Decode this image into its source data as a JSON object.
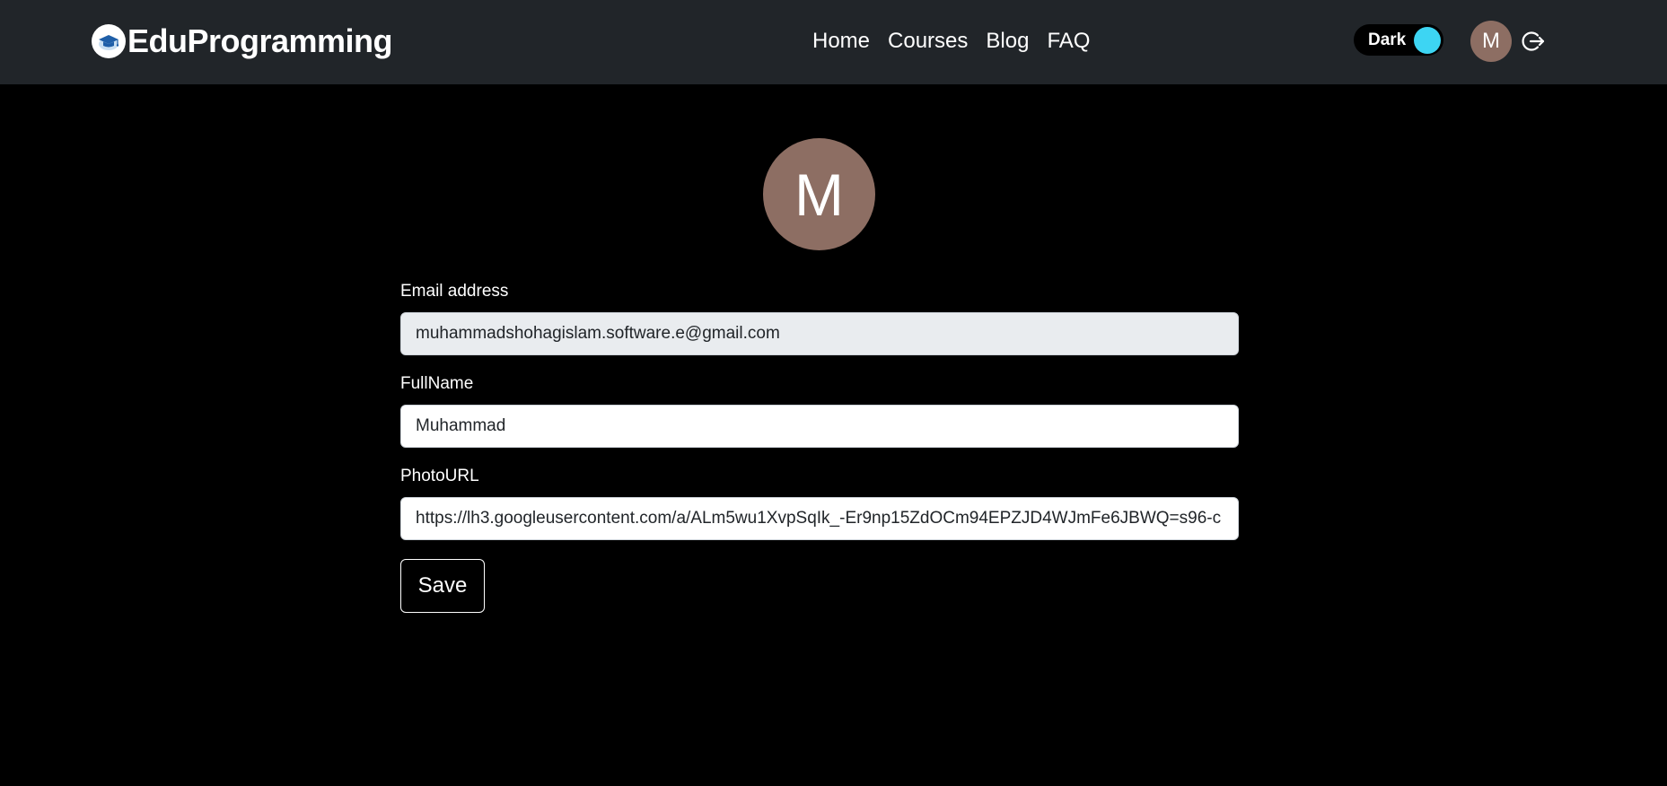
{
  "navbar": {
    "brand_name": "EduProgramming",
    "links": [
      {
        "label": "Home"
      },
      {
        "label": "Courses"
      },
      {
        "label": "Blog"
      },
      {
        "label": "FAQ"
      }
    ],
    "theme_toggle_label": "Dark",
    "avatar_initial": "M",
    "logout_icon": "logout-icon"
  },
  "profile": {
    "avatar_initial": "M",
    "email_label": "Email address",
    "email_value": "muhammadshohagislam.software.e@gmail.com",
    "fullname_label": "FullName",
    "fullname_value": "Muhammad",
    "photourl_label": "PhotoURL",
    "photourl_value": "https://lh3.googleusercontent.com/a/ALm5wu1XvpSqIk_-Er9np15ZdOCm94EPZJD4WJmFe6JBWQ=s96-c",
    "save_label": "Save"
  },
  "colors": {
    "navbar_bg": "#212529",
    "page_bg": "#000000",
    "avatar_bg": "#8d6e63",
    "toggle_knob": "#3dd5f3"
  }
}
